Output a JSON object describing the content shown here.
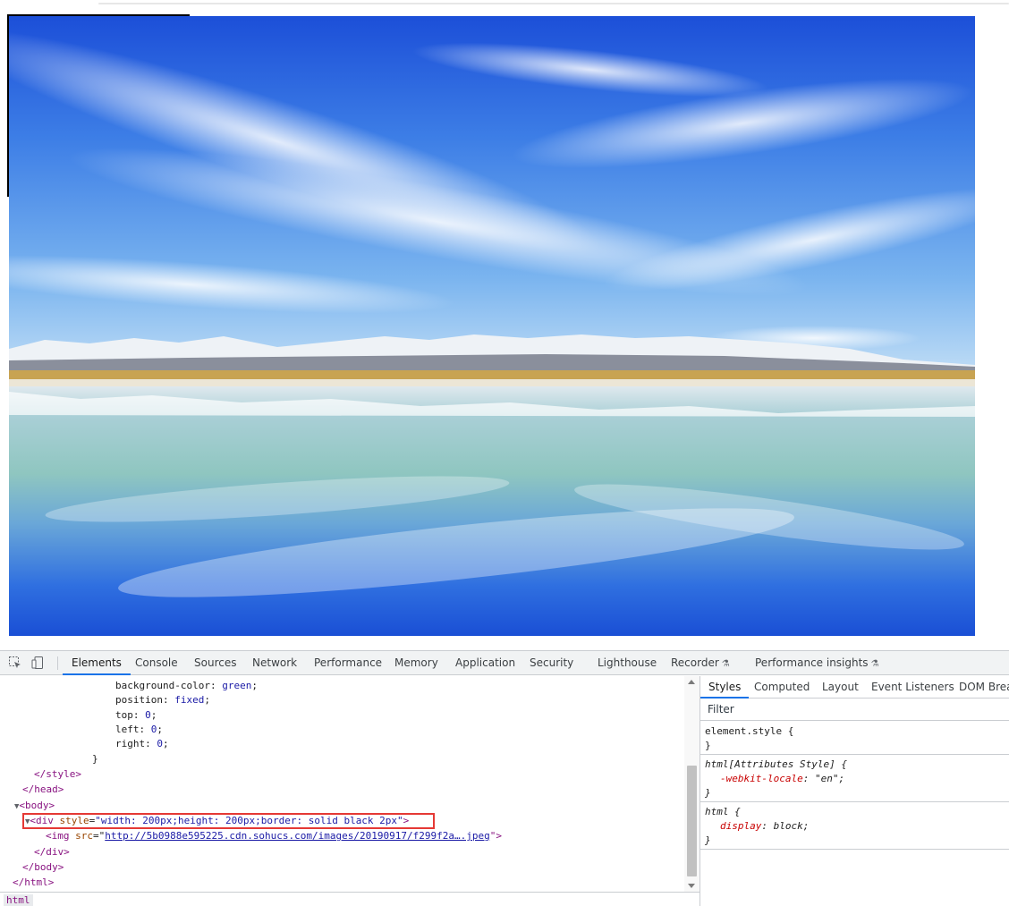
{
  "devtools": {
    "tabs": [
      "Elements",
      "Console",
      "Sources",
      "Network",
      "Performance",
      "Memory",
      "Application",
      "Security",
      "Lighthouse",
      "Recorder",
      "Performance insights"
    ],
    "active_tab": "Elements",
    "breadcrumb": "html",
    "code": {
      "line1": "background-color: ",
      "line1_val": "green",
      "line2": "position: ",
      "line2_val": "fixed",
      "line3": "top: ",
      "line3_val": "0",
      "line4": "left: ",
      "line4_val": "0",
      "line5": "right: ",
      "line5_val": "0",
      "close_brace": "}",
      "style_close": "</style>",
      "head_close": "</head>",
      "body_open": "<body>",
      "div_open_tag": "<div ",
      "div_attr_name": "style",
      "div_attr_value": "\"width: 200px;height: 200px;border: solid black 2px\"",
      "div_open_end": ">",
      "img_tag": "<img ",
      "img_attr_name": "src",
      "img_attr_value": "http://5b0988e595225.cdn.sohucs.com/images/20190917/f299f2a….jpeg",
      "img_end": "\">",
      "div_close": "</div>",
      "body_close": "</body>",
      "html_close": "</html>"
    },
    "styles": {
      "tabs": [
        "Styles",
        "Computed",
        "Layout",
        "Event Listeners",
        "DOM Breal"
      ],
      "active_tab": "Styles",
      "filter_placeholder": "Filter",
      "rule1_selector": "element.style {",
      "rule1_close": "}",
      "rule2_selector": "html[Attributes Style] {",
      "rule2_prop": "-webkit-locale",
      "rule2_val": ": \"en\";",
      "rule2_close": "}",
      "rule3_selector": "html {",
      "rule3_prop": "display",
      "rule3_val": ": block;",
      "rule3_close": "}"
    }
  }
}
